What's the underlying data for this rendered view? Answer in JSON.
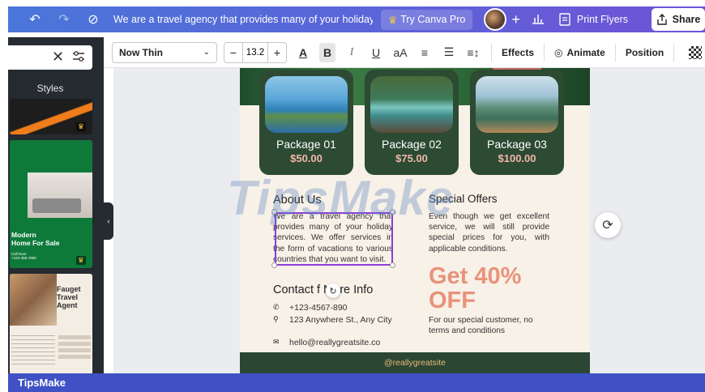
{
  "topbar": {
    "undo_icon": "undo-icon",
    "redo_icon": "redo-icon",
    "saved_icon": "cloud-check-icon",
    "title": "We are a travel agency that provides many of your holiday s...",
    "pro_label": "Try Canva Pro",
    "plus": "+",
    "print_label": "Print Flyers",
    "share_label": "Share"
  },
  "left_panel": {
    "styles_label": "Styles",
    "template2_title": "Modern\nHome For Sale",
    "template2_small": "Call Now:\n+123-456-7890",
    "template3_title": "Fauget\nTravel\nAgent"
  },
  "toolbar": {
    "font": "Now Thin",
    "size_minus": "−",
    "font_size": "13.2",
    "size_plus": "+",
    "text_color": "A",
    "bold": "B",
    "italic": "I",
    "underline": "U",
    "case": "aA",
    "align": "≡",
    "list": "☰",
    "spacing": "≡↕",
    "effects": "Effects",
    "animate": "Animate",
    "position": "Position"
  },
  "design": {
    "packages": [
      {
        "name": "Package 01",
        "price": "$50.00"
      },
      {
        "name": "Package 02",
        "price": "$75.00"
      },
      {
        "name": "Package 03",
        "price": "$100.00"
      }
    ],
    "about_heading": "About Us",
    "about_text": "We are a travel agency that provides many of your holiday services. We offer services in the form of vacations to various countries that you want to visit.",
    "special_heading": "Special Offers",
    "special_text": "Even though we get excellent service, we will still provide special prices for you, with applicable conditions.",
    "contact_heading": "Contact f  More Info",
    "phone": "+123-4567-890",
    "address": "123 Anywhere St., Any City",
    "email": "hello@reallygreatsite.co",
    "offer_big": "Get 40% OFF",
    "offer_text": "For our special customer, no terms and conditions",
    "footer": "@reallygreatsite"
  },
  "watermark": "TipsMake",
  "bottom_label": "TipsMake",
  "colors": {
    "topbar": "#5c63d8",
    "package_green": "#2d4a33",
    "accent_salmon": "#e9927a",
    "selection_purple": "#8b3fd6"
  }
}
